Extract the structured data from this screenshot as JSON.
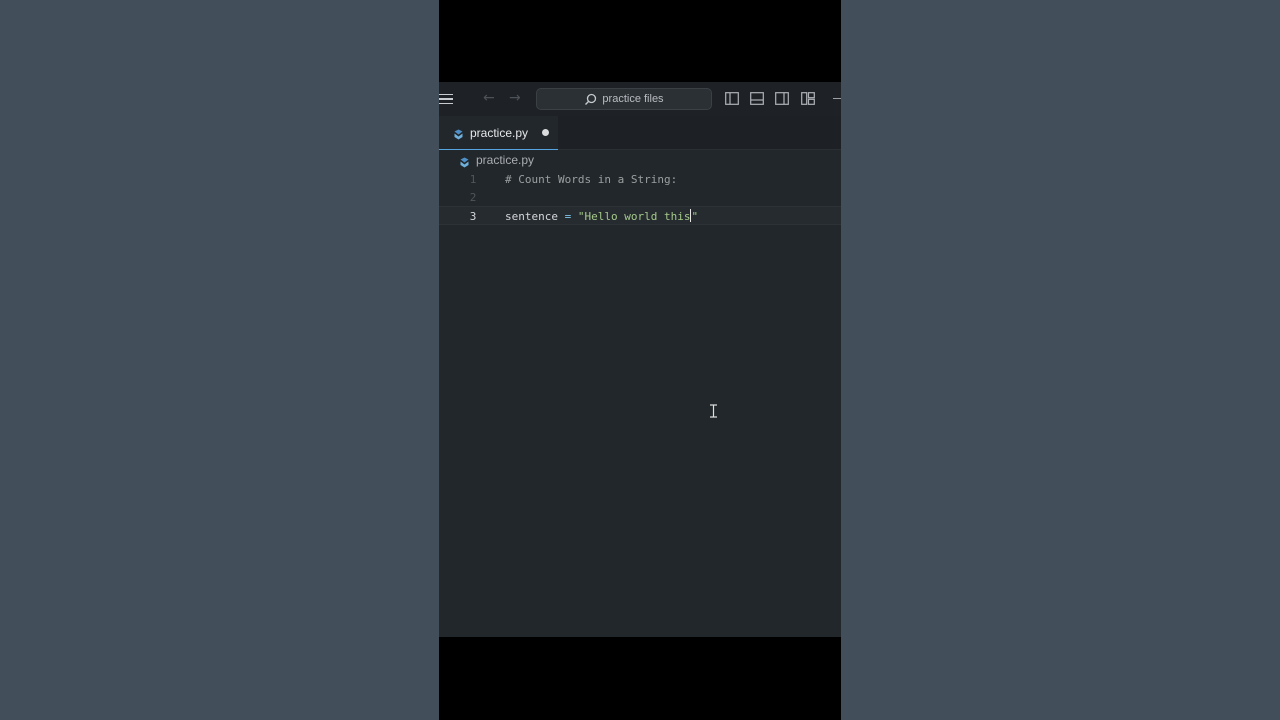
{
  "titlebar": {
    "search_placeholder": "practice files",
    "icons": [
      "menu-icon",
      "back-arrow-icon",
      "forward-arrow-icon",
      "search-icon",
      "toggle-primary-sidebar-icon",
      "toggle-panel-icon",
      "toggle-secondary-sidebar-icon",
      "customize-layout-icon"
    ]
  },
  "tabs": [
    {
      "label": "practice.py",
      "modified": true,
      "active": true
    }
  ],
  "breadcrumb": {
    "file": "practice.py"
  },
  "editor": {
    "lines": [
      {
        "number": "1",
        "comment": "# Count Words in a String:"
      },
      {
        "number": "2"
      },
      {
        "number": "3",
        "var": "sentence",
        "op": " = ",
        "str": "\"Hello world this",
        "str_end": "\""
      }
    ],
    "active_line": 3
  },
  "colors": {
    "editor_bg": "#22272b",
    "outer_bg": "#424e59",
    "accent": "#55a6e0",
    "string": "#a5c98a",
    "operator": "#7ec6e8"
  }
}
